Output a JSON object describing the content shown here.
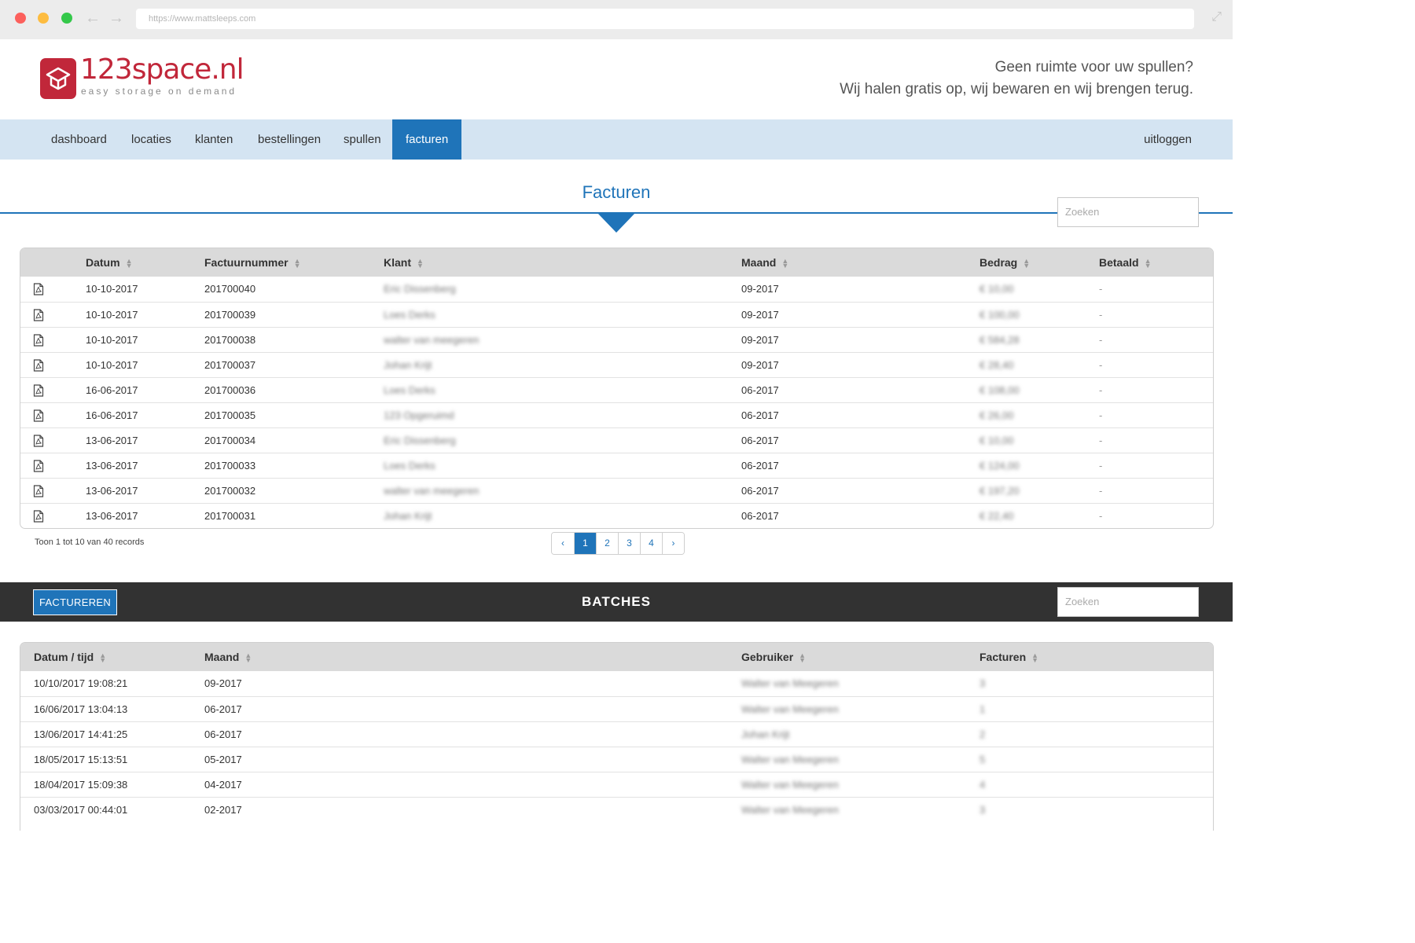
{
  "browser": {
    "url": "https://www.mattsleeps.com"
  },
  "header": {
    "logo_text": "123space.nl",
    "logo_sub": "easy storage on demand",
    "tagline_line1": "Geen ruimte voor uw spullen?",
    "tagline_line2": "Wij halen gratis op, wij bewaren en wij brengen terug."
  },
  "nav": {
    "items": [
      "dashboard",
      "locaties",
      "klanten",
      "bestellingen",
      "spullen",
      "facturen"
    ],
    "active": "facturen",
    "logout": "uitloggen"
  },
  "facturen": {
    "title": "Facturen",
    "search_placeholder": "Zoeken",
    "columns": [
      "Datum",
      "Factuurnummer",
      "Klant",
      "Maand",
      "Bedrag",
      "Betaald"
    ],
    "rows": [
      {
        "datum": "10-10-2017",
        "nummer": "201700040",
        "klant": "Eric Dissenberg",
        "maand": "09-2017",
        "bedrag": "€ 10,00",
        "betaald": "-"
      },
      {
        "datum": "10-10-2017",
        "nummer": "201700039",
        "klant": "Loes Derks",
        "maand": "09-2017",
        "bedrag": "€ 100,00",
        "betaald": "-"
      },
      {
        "datum": "10-10-2017",
        "nummer": "201700038",
        "klant": "walter van meegeren",
        "maand": "09-2017",
        "bedrag": "€ 584,28",
        "betaald": "-"
      },
      {
        "datum": "10-10-2017",
        "nummer": "201700037",
        "klant": "Johan Krijt",
        "maand": "09-2017",
        "bedrag": "€ 28,40",
        "betaald": "-"
      },
      {
        "datum": "16-06-2017",
        "nummer": "201700036",
        "klant": "Loes Derks",
        "maand": "06-2017",
        "bedrag": "€ 108,00",
        "betaald": "-"
      },
      {
        "datum": "16-06-2017",
        "nummer": "201700035",
        "klant": "123 Opgeruimd",
        "maand": "06-2017",
        "bedrag": "€ 26,00",
        "betaald": "-"
      },
      {
        "datum": "13-06-2017",
        "nummer": "201700034",
        "klant": "Eric Dissenberg",
        "maand": "06-2017",
        "bedrag": "€ 10,00",
        "betaald": "-"
      },
      {
        "datum": "13-06-2017",
        "nummer": "201700033",
        "klant": "Loes Derks",
        "maand": "06-2017",
        "bedrag": "€ 124,00",
        "betaald": "-"
      },
      {
        "datum": "13-06-2017",
        "nummer": "201700032",
        "klant": "walter van meegeren",
        "maand": "06-2017",
        "bedrag": "€ 197,20",
        "betaald": "-"
      },
      {
        "datum": "13-06-2017",
        "nummer": "201700031",
        "klant": "Johan Krijt",
        "maand": "06-2017",
        "bedrag": "€ 22,40",
        "betaald": "-"
      }
    ],
    "info": "Toon 1 tot 10 van 40 records",
    "pagination": {
      "prev": "‹",
      "pages": [
        "1",
        "2",
        "3",
        "4"
      ],
      "active": "1",
      "next": "›"
    }
  },
  "batches": {
    "title": "BATCHES",
    "button": "FACTUREREN",
    "search_placeholder": "Zoeken",
    "columns": [
      "Datum / tijd",
      "Maand",
      "Gebruiker",
      "Facturen"
    ],
    "rows": [
      {
        "datum": "10/10/2017 19:08:21",
        "maand": "09-2017",
        "gebruiker": "Walter van Meegeren",
        "facturen": "3"
      },
      {
        "datum": "16/06/2017 13:04:13",
        "maand": "06-2017",
        "gebruiker": "Walter van Meegeren",
        "facturen": "1"
      },
      {
        "datum": "13/06/2017 14:41:25",
        "maand": "06-2017",
        "gebruiker": "Johan Krijt",
        "facturen": "2"
      },
      {
        "datum": "18/05/2017 15:13:51",
        "maand": "05-2017",
        "gebruiker": "Walter van Meegeren",
        "facturen": "5"
      },
      {
        "datum": "18/04/2017 15:09:38",
        "maand": "04-2017",
        "gebruiker": "Walter van Meegeren",
        "facturen": "4"
      },
      {
        "datum": "03/03/2017 00:44:01",
        "maand": "02-2017",
        "gebruiker": "Walter van Meegeren",
        "facturen": "3"
      }
    ]
  },
  "colors": {
    "brand_red": "#c1273a",
    "accent_blue": "#1f74b9",
    "nav_bg": "#d4e4f2",
    "batch_bar": "#323232"
  }
}
